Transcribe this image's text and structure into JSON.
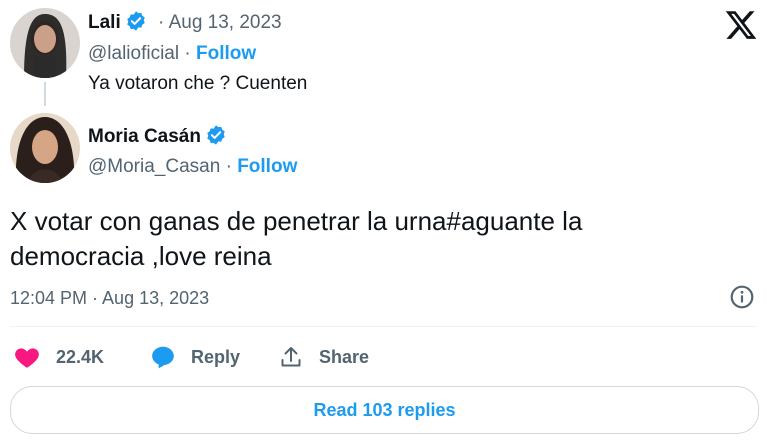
{
  "reply_to": {
    "name": "Lali",
    "date": "Aug 13, 2023",
    "handle": "@lalioficial",
    "follow": "Follow",
    "text": "Ya votaron che ? Cuenten"
  },
  "tweet": {
    "name": "Moria Casán",
    "handle": "@Moria_Casan",
    "follow": "Follow",
    "text": "X votar con ganas de penetrar la urna#aguante la democracia ,love reina",
    "timestamp": "12:04 PM · Aug 13, 2023"
  },
  "actions": {
    "likes": "22.4K",
    "reply": "Reply",
    "share": "Share"
  },
  "read_replies": "Read 103 replies",
  "separator": "·",
  "colors": {
    "accent": "#1d9bf0",
    "like": "#f91880",
    "text": "#0f1419",
    "muted": "#536471"
  },
  "icons": [
    "x-logo-icon",
    "verified-badge-icon",
    "heart-icon",
    "reply-bubble-icon",
    "share-upload-icon",
    "info-icon"
  ]
}
